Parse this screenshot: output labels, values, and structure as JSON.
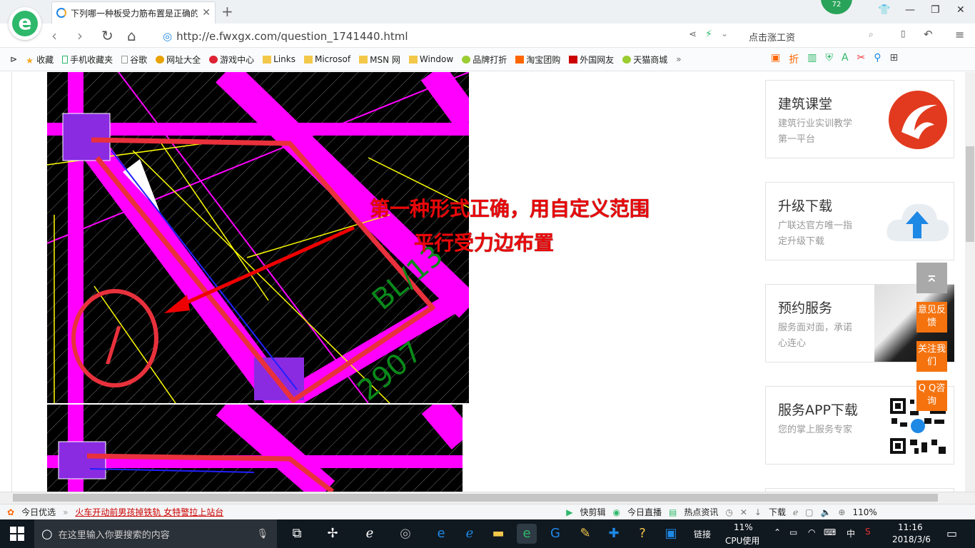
{
  "browser": {
    "tab_title": "下列哪一种板受力筋布置是正确的",
    "badge_count": "72",
    "url": "http://e.fwxgx.com/question_1741440.html",
    "search_placeholder": "点击涨工资",
    "bookmarks": [
      "收藏",
      "手机收藏夹",
      "谷歌",
      "网址大全",
      "游戏中心",
      "Links",
      "Microsof",
      "MSN 网",
      "Window",
      "品牌打折",
      "淘宝团购",
      "外国网友",
      "天猫商城"
    ],
    "more": "»"
  },
  "content": {
    "annotation_line1": "第一种形式正确，用自定义范围",
    "annotation_line2": "平行受力边布置",
    "cad_label1": "BL/13",
    "cad_label2": "2907",
    "circle_mark": "/"
  },
  "sidebar": [
    {
      "title": "建筑课堂",
      "desc": "建筑行业实训教学第一平台",
      "icon": "guanglianda-logo-icon"
    },
    {
      "title": "升级下载",
      "desc": "广联达官方唯一指定升级下载",
      "icon": "cloud-upload-icon"
    },
    {
      "title": "预约服务",
      "desc": "服务面对面，承诺心连心",
      "icon": "handshake-photo-icon"
    },
    {
      "title": "服务APP下载",
      "desc": "您的掌上服务专家",
      "icon": "qr-code-icon"
    }
  ],
  "float_buttons": [
    "意见反馈",
    "关注我们",
    "Q Q咨询"
  ],
  "statusbar": {
    "today_pick": "今日优选",
    "news": "火车开动前男孩掉铁轨 女特警拉上站台",
    "items": [
      "快剪辑",
      "今日直播",
      "热点资讯",
      "下载"
    ],
    "zoom": "110%"
  },
  "taskbar": {
    "search_placeholder": "在这里输入你要搜索的内容",
    "network": "链接",
    "cpu_pct": "11%",
    "cpu_label": "CPU使用",
    "ime": "中",
    "time": "11:16",
    "date": "2018/3/6"
  },
  "colors": {
    "accent_green": "#2db86a",
    "annot_red": "#e8080a",
    "float_orange": "#f5730f",
    "cad_magenta": "#ff00ff"
  }
}
